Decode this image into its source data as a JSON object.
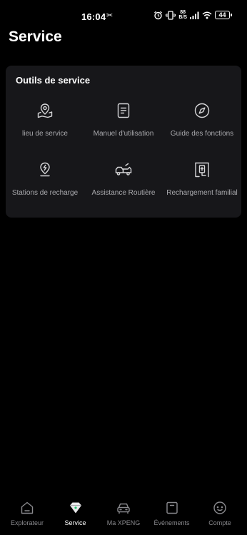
{
  "status_bar": {
    "time": "16:04",
    "bluetooth_glyph": "✂",
    "net_speed_top": "88",
    "net_speed_bottom": "B/S",
    "battery": "44"
  },
  "header": {
    "title": "Service"
  },
  "tools": {
    "title": "Outils de service",
    "items": [
      {
        "label": "lieu de service",
        "icon": "map-pin-icon"
      },
      {
        "label": "Manuel d'utilisation",
        "icon": "manual-icon"
      },
      {
        "label": "Guide des fonctions",
        "icon": "compass-icon"
      },
      {
        "label": "Stations de recharge",
        "icon": "charging-station-icon"
      },
      {
        "label": "Assistance Routière",
        "icon": "tow-truck-icon"
      },
      {
        "label": "Rechargement familial",
        "icon": "home-charger-icon"
      }
    ]
  },
  "bottom_nav": {
    "active": "Service",
    "items": [
      {
        "label": "Explorateur",
        "icon": "home-icon"
      },
      {
        "label": "Service",
        "icon": "service-diamond-icon"
      },
      {
        "label": "Ma XPENG",
        "icon": "car-icon"
      },
      {
        "label": "Événements",
        "icon": "events-bag-icon"
      },
      {
        "label": "Compte",
        "icon": "account-icon"
      }
    ]
  },
  "colors": {
    "background": "#000000",
    "card": "#17171a",
    "label": "#a9a9ad",
    "nav_inactive": "#8a8a8e",
    "accent": "#25c16f"
  }
}
